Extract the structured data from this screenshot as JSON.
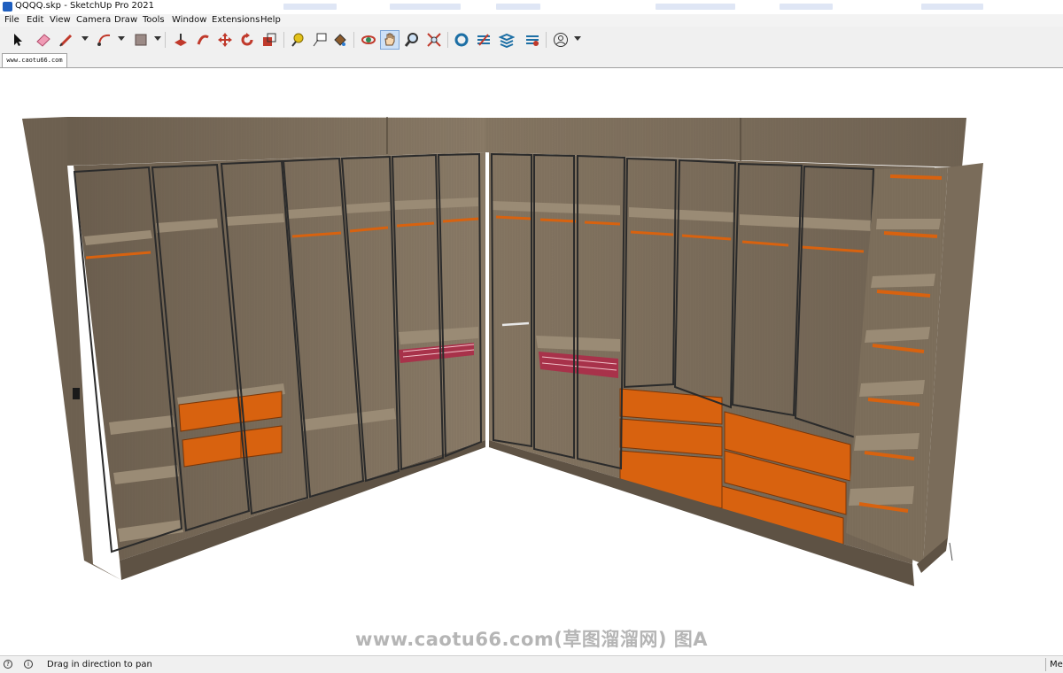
{
  "window": {
    "title": "QQQQ.skp - SketchUp Pro 2021"
  },
  "menu": [
    "File",
    "Edit",
    "View",
    "Camera",
    "Draw",
    "Tools",
    "Window",
    "Extensions",
    "Help"
  ],
  "toolbar": {
    "tools": [
      "select-icon",
      "eraser-icon",
      "line-pencil-icon",
      "arc-icon",
      "rectangle-shape-icon",
      "push-pull-icon",
      "follow-me-icon",
      "move-icon",
      "rotate-icon",
      "scale-icon",
      "tape-measure-icon",
      "text-label-icon",
      "paint-bucket-icon",
      "orbit-icon",
      "pan-icon",
      "zoom-icon",
      "zoom-extents-icon",
      "warehouse-icon",
      "extension-warehouse-icon",
      "layout-icon",
      "extension-manager-icon",
      "account-icon"
    ],
    "active_tool": "pan-icon"
  },
  "tab": {
    "label": "www.caotu66.com"
  },
  "viewport": {
    "watermark": "www.caotu66.com(草图溜溜网) 图A"
  },
  "status": {
    "message": "Drag in direction to pan",
    "measurements_label": "Me"
  },
  "colors": {
    "wood": "#7a6c5a",
    "wood_dark": "#5e5244",
    "accent_orange": "#d8620f",
    "frame": "#2b2b2b"
  }
}
